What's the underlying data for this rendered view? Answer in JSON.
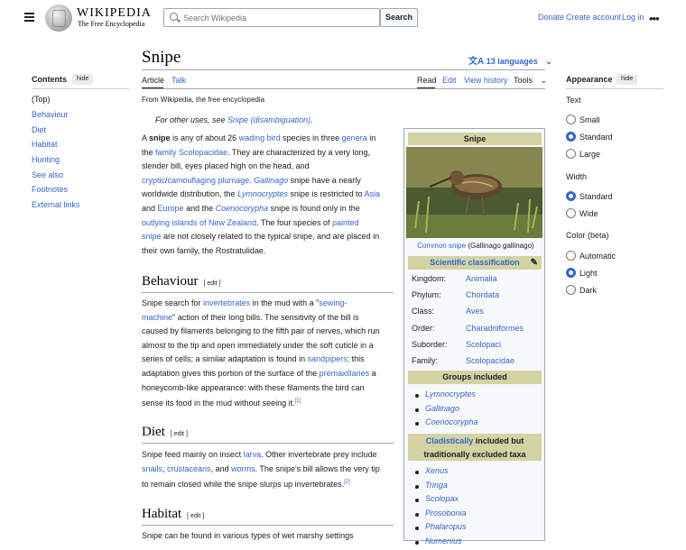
{
  "header": {
    "logo_word": "WIKIPEDIA",
    "logo_tagline": "The Free Encyclopedia",
    "search_placeholder": "Search Wikipedia",
    "search_button": "Search",
    "links": [
      "Donate",
      "Create account",
      "Log in"
    ],
    "more": "•••"
  },
  "toc": {
    "title": "Contents",
    "hide": "hide",
    "items": [
      "(Top)",
      "Behaviour",
      "Diet",
      "Habitat",
      "Hunting",
      "See also",
      "Footnotes",
      "External links"
    ]
  },
  "page": {
    "title": "Snipe",
    "languages": "13 languages",
    "tabs_left": [
      "Article",
      "Talk"
    ],
    "tabs_right": [
      "Read",
      "Edit",
      "View history",
      "Tools"
    ],
    "from": "From Wikipedia, the free encyclopedia",
    "hatnote_prefix": "For other uses, see ",
    "hatnote_link": "Snipe (disambiguation)",
    "hatnote_suffix": "."
  },
  "lead": {
    "l1_a": "A ",
    "l1_b": "snipe",
    "l1_c": " is any of about 26 ",
    "l1_d": "wading bird",
    "l1_e": " species in three ",
    "l1_f": "genera",
    "l1_g": " in",
    "l2_a": "the ",
    "l2_b": "family",
    "l2_c": " ",
    "l2_d": "Scolopacidae",
    "l2_e": ". They are characterized by a very long,",
    "l3": "slender bill, eyes placed high on the head, and",
    "l4_a": "cryptic",
    "l4_b": "/",
    "l4_c": "camouflaging",
    "l4_d": " ",
    "l4_e": "plumage",
    "l4_f": ". ",
    "l4_g": "Gallinago",
    "l4_h": " snipe have a nearly",
    "l5_a": "worldwide distribution, the ",
    "l5_b": "Lymnocryptes",
    "l5_c": " snipe is restricted to ",
    "l5_d": "Asia",
    "l6_a": "and ",
    "l6_b": "Europe",
    "l6_c": " and the ",
    "l6_d": "Coenocorypha",
    "l6_e": " snipe is found only in the",
    "l7_a": "outlying islands of New Zealand",
    "l7_b": ". The four species of ",
    "l7_c": "painted",
    "l8_a": "snipe",
    "l8_b": " are not closely related to the typical snipe, and are placed in",
    "l9": "their own family, the Rostratulidae."
  },
  "behaviour": {
    "heading": "Behaviour",
    "edit": "[ edit ]",
    "l1_a": "Snipe search for ",
    "l1_b": "invertebrates",
    "l1_c": " in the mud with a \"",
    "l1_d": "sewing-",
    "l2_a": "machine",
    "l2_b": "\" action of their long bills. The sensitivity of the bill is",
    "l3": "caused by filaments belonging to the fifth pair of nerves, which run",
    "l4": "almost to the tip and open immediately under the soft cuticle in a",
    "l5_a": "series of cells; a similar adaptation is found in ",
    "l5_b": "sandpipers",
    "l5_c": "; this",
    "l6_a": "adaptation gives this portion of the surface of the ",
    "l6_b": "premaxillaries",
    "l6_c": " a",
    "l7": "honeycomb-like appearance: with these filaments the bird can",
    "l8_a": "sense its food in the mud without seeing it.",
    "l8_ref": "[1]"
  },
  "diet": {
    "heading": "Diet",
    "edit": "[ edit ]",
    "l1_a": "Snipe feed mainly on insect ",
    "l1_b": "larva",
    "l1_c": ". Other invertebrate prey include",
    "l2_a": "snails",
    "l2_b": ", ",
    "l2_c": "crustaceans",
    "l2_d": ", and ",
    "l2_e": "worms",
    "l2_f": ". The snipe's bill allows the very tip",
    "l3_a": "to remain closed while the snipe slurps up invertebrates.",
    "l3_ref": "[2]"
  },
  "habitat": {
    "heading": "Habitat",
    "edit": "[ edit ]",
    "l1": "Snipe can be found in various types of wet marshy settings"
  },
  "infobox": {
    "title": "Snipe",
    "caption_link": "Common snipe",
    "caption_sci": " (Gallinago gallinago)",
    "classification": "Scientific classification",
    "rows": [
      {
        "k": "Kingdom:",
        "v": "Animalia"
      },
      {
        "k": "Phylum:",
        "v": "Chordata"
      },
      {
        "k": "Class:",
        "v": "Aves"
      },
      {
        "k": "Order:",
        "v": "Charadriiformes"
      },
      {
        "k": "Suborder:",
        "v": "Scolopaci"
      },
      {
        "k": "Family:",
        "v": "Scolopacidae"
      }
    ],
    "groups_heading": "Groups included",
    "groups": [
      "Lymnocryptes",
      "Gallinago",
      "Coenocorypha"
    ],
    "excluded_heading_link": "Cladistically",
    "excluded_heading_rest": " included but",
    "excluded_heading_line2": "traditionally excluded taxa",
    "excluded": [
      "Xenus",
      "Tringa",
      "Scolopax",
      "Prosobonia",
      "Phalaropus",
      "Numenius"
    ]
  },
  "appearance": {
    "title": "Appearance",
    "hide": "hide",
    "text_label": "Text",
    "text_options": [
      "Small",
      "Standard",
      "Large"
    ],
    "text_selected": "Standard",
    "width_label": "Width",
    "width_options": [
      "Standard",
      "Wide"
    ],
    "width_selected": "Standard",
    "color_label": "Color (beta)",
    "color_options": [
      "Automatic",
      "Light",
      "Dark"
    ],
    "color_selected": "Light"
  },
  "colors": {
    "link": "#3366cc",
    "infobox_header": "#d3d3a4",
    "radio_on": "#3366cc"
  }
}
